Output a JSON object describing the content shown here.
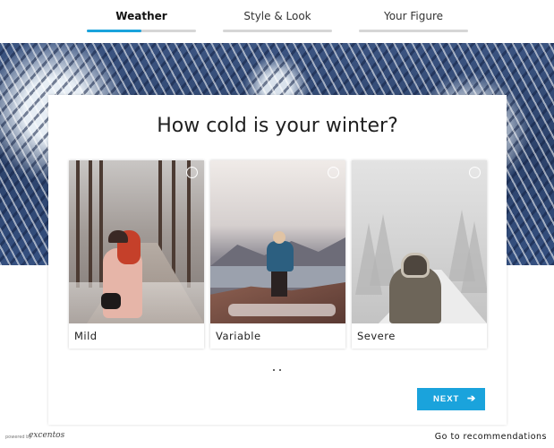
{
  "steps": [
    {
      "label": "Weather",
      "progress": 0.5,
      "active": true
    },
    {
      "label": "Style & Look",
      "progress": 0,
      "active": false
    },
    {
      "label": "Your Figure",
      "progress": 0,
      "active": false
    }
  ],
  "colors": {
    "accent": "#1aa3dc",
    "track": "#d6d6d6",
    "banner": "#2b4169"
  },
  "question": "How cold is your winter?",
  "options": [
    {
      "label": "Mild",
      "selected": false
    },
    {
      "label": "Variable",
      "selected": false
    },
    {
      "label": "Severe",
      "selected": false
    }
  ],
  "pager": {
    "pages": 2,
    "current": 1
  },
  "next_button": {
    "label": "NEXT",
    "icon": "arrow-right-icon"
  },
  "footer": {
    "powered_by": "powered by",
    "brand": "excentos",
    "link": "Go to recommendations"
  }
}
